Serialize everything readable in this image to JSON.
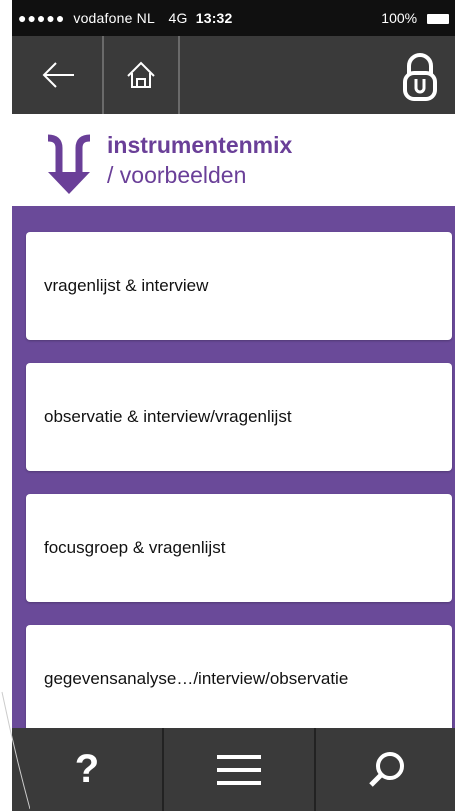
{
  "status_bar": {
    "carrier": "vodafone NL",
    "network": "4G",
    "time": "13:32",
    "battery": "100%",
    "signal_dots": "●●●●●"
  },
  "nav_bar": {
    "back_icon": "arrow-left-icon",
    "home_icon": "home-icon",
    "lock_icon": "lock-icon"
  },
  "header": {
    "title": "instrumentenmix",
    "subtitle": "/ voorbeelden",
    "logo_icon": "split-arrow-down-icon",
    "accent_color": "#6a3f98"
  },
  "list": {
    "background_color": "#6a4a99",
    "items": [
      {
        "label": "vragenlijst & interview"
      },
      {
        "label": "observatie & interview/vragenlijst"
      },
      {
        "label": "focusgroep & vragenlijst"
      },
      {
        "label": "gegevensanalyse…/interview/observatie"
      }
    ]
  },
  "tab_bar": {
    "help_label": "?",
    "menu_icon": "hamburger-menu-icon",
    "search_icon": "search-icon"
  }
}
